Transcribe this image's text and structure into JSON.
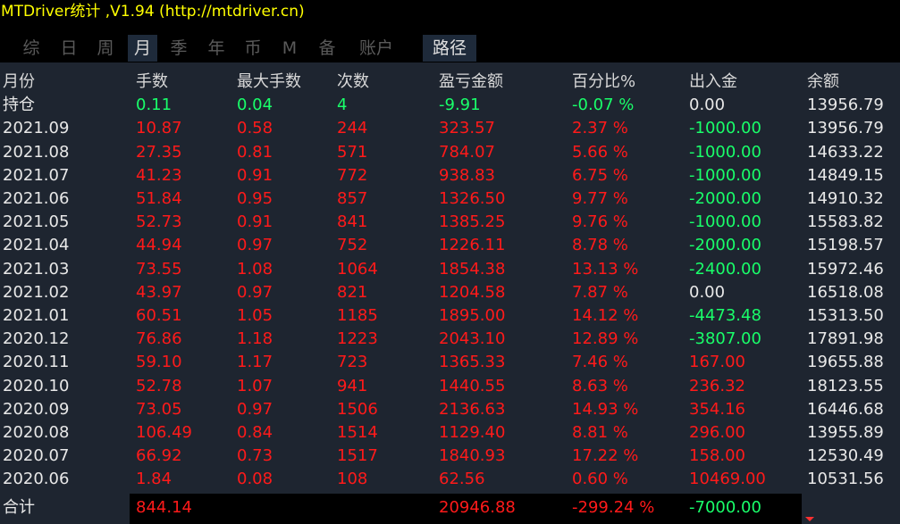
{
  "window": {
    "title": "MTDriver统计 ,V1.94 (http://mtdriver.cn)"
  },
  "tabs": [
    {
      "label": "综",
      "active": false
    },
    {
      "label": "日",
      "active": false
    },
    {
      "label": "周",
      "active": false
    },
    {
      "label": "月",
      "active": true
    },
    {
      "label": "季",
      "active": false
    },
    {
      "label": "年",
      "active": false
    },
    {
      "label": "币",
      "active": false
    },
    {
      "label": "M",
      "active": false
    },
    {
      "label": "备",
      "active": false
    },
    {
      "label": "账户",
      "active": false
    },
    {
      "label": "路径",
      "active": false
    }
  ],
  "table": {
    "headers": [
      "月份",
      "手数",
      "最大手数",
      "次数",
      "盈亏金额",
      "百分比%",
      "出入金",
      "余额"
    ],
    "rows": [
      [
        "持仓",
        "0.11",
        "0.04",
        "4",
        "-9.91",
        "-0.07 %",
        "0.00",
        "13956.79"
      ],
      [
        "2021.09",
        "10.87",
        "0.58",
        "244",
        "323.57",
        "2.37 %",
        "-1000.00",
        "13956.79"
      ],
      [
        "2021.08",
        "27.35",
        "0.81",
        "571",
        "784.07",
        "5.66 %",
        "-1000.00",
        "14633.22"
      ],
      [
        "2021.07",
        "41.23",
        "0.91",
        "772",
        "938.83",
        "6.75 %",
        "-1000.00",
        "14849.15"
      ],
      [
        "2021.06",
        "51.84",
        "0.95",
        "857",
        "1326.50",
        "9.77 %",
        "-2000.00",
        "14910.32"
      ],
      [
        "2021.05",
        "52.73",
        "0.91",
        "841",
        "1385.25",
        "9.76 %",
        "-1000.00",
        "15583.82"
      ],
      [
        "2021.04",
        "44.94",
        "0.97",
        "752",
        "1226.11",
        "8.78 %",
        "-2000.00",
        "15198.57"
      ],
      [
        "2021.03",
        "73.55",
        "1.08",
        "1064",
        "1854.38",
        "13.13 %",
        "-2400.00",
        "15972.46"
      ],
      [
        "2021.02",
        "43.97",
        "0.97",
        "821",
        "1204.58",
        "7.87 %",
        "0.00",
        "16518.08"
      ],
      [
        "2021.01",
        "60.51",
        "1.05",
        "1185",
        "1895.00",
        "14.12 %",
        "-4473.48",
        "15313.50"
      ],
      [
        "2020.12",
        "76.86",
        "1.18",
        "1223",
        "2043.10",
        "12.89 %",
        "-3807.00",
        "17891.98"
      ],
      [
        "2020.11",
        "59.10",
        "1.17",
        "723",
        "1365.33",
        "7.46 %",
        "167.00",
        "19655.88"
      ],
      [
        "2020.10",
        "52.78",
        "1.07",
        "941",
        "1440.55",
        "8.63 %",
        "236.32",
        "18123.55"
      ],
      [
        "2020.09",
        "73.05",
        "0.97",
        "1506",
        "2136.63",
        "14.93 %",
        "354.16",
        "16446.68"
      ],
      [
        "2020.08",
        "106.49",
        "0.84",
        "1514",
        "1129.40",
        "8.81 %",
        "296.00",
        "13955.89"
      ],
      [
        "2020.07",
        "66.92",
        "0.73",
        "1517",
        "1840.93",
        "17.22 %",
        "158.00",
        "12530.49"
      ],
      [
        "2020.06",
        "1.84",
        "0.08",
        "108",
        "62.56",
        "0.60 %",
        "10469.00",
        "10531.56"
      ]
    ],
    "row_colors": [
      [
        "#e8e8e8",
        "#19ff6a",
        "#19ff6a",
        "#19ff6a",
        "#19ff6a",
        "#19ff6a",
        "#e8e8e8",
        "#e8e8e8"
      ],
      [
        "#e8e8e8",
        "#ff1a1a",
        "#ff1a1a",
        "#ff1a1a",
        "#ff1a1a",
        "#ff1a1a",
        "#19ff6a",
        "#e8e8e8"
      ],
      [
        "#e8e8e8",
        "#ff1a1a",
        "#ff1a1a",
        "#ff1a1a",
        "#ff1a1a",
        "#ff1a1a",
        "#19ff6a",
        "#e8e8e8"
      ],
      [
        "#e8e8e8",
        "#ff1a1a",
        "#ff1a1a",
        "#ff1a1a",
        "#ff1a1a",
        "#ff1a1a",
        "#19ff6a",
        "#e8e8e8"
      ],
      [
        "#e8e8e8",
        "#ff1a1a",
        "#ff1a1a",
        "#ff1a1a",
        "#ff1a1a",
        "#ff1a1a",
        "#19ff6a",
        "#e8e8e8"
      ],
      [
        "#e8e8e8",
        "#ff1a1a",
        "#ff1a1a",
        "#ff1a1a",
        "#ff1a1a",
        "#ff1a1a",
        "#19ff6a",
        "#e8e8e8"
      ],
      [
        "#e8e8e8",
        "#ff1a1a",
        "#ff1a1a",
        "#ff1a1a",
        "#ff1a1a",
        "#ff1a1a",
        "#19ff6a",
        "#e8e8e8"
      ],
      [
        "#e8e8e8",
        "#ff1a1a",
        "#ff1a1a",
        "#ff1a1a",
        "#ff1a1a",
        "#ff1a1a",
        "#19ff6a",
        "#e8e8e8"
      ],
      [
        "#e8e8e8",
        "#ff1a1a",
        "#ff1a1a",
        "#ff1a1a",
        "#ff1a1a",
        "#ff1a1a",
        "#e8e8e8",
        "#e8e8e8"
      ],
      [
        "#e8e8e8",
        "#ff1a1a",
        "#ff1a1a",
        "#ff1a1a",
        "#ff1a1a",
        "#ff1a1a",
        "#19ff6a",
        "#e8e8e8"
      ],
      [
        "#e8e8e8",
        "#ff1a1a",
        "#ff1a1a",
        "#ff1a1a",
        "#ff1a1a",
        "#ff1a1a",
        "#19ff6a",
        "#e8e8e8"
      ],
      [
        "#e8e8e8",
        "#ff1a1a",
        "#ff1a1a",
        "#ff1a1a",
        "#ff1a1a",
        "#ff1a1a",
        "#ff1a1a",
        "#e8e8e8"
      ],
      [
        "#e8e8e8",
        "#ff1a1a",
        "#ff1a1a",
        "#ff1a1a",
        "#ff1a1a",
        "#ff1a1a",
        "#ff1a1a",
        "#e8e8e8"
      ],
      [
        "#e8e8e8",
        "#ff1a1a",
        "#ff1a1a",
        "#ff1a1a",
        "#ff1a1a",
        "#ff1a1a",
        "#ff1a1a",
        "#e8e8e8"
      ],
      [
        "#e8e8e8",
        "#ff1a1a",
        "#ff1a1a",
        "#ff1a1a",
        "#ff1a1a",
        "#ff1a1a",
        "#ff1a1a",
        "#e8e8e8"
      ],
      [
        "#e8e8e8",
        "#ff1a1a",
        "#ff1a1a",
        "#ff1a1a",
        "#ff1a1a",
        "#ff1a1a",
        "#ff1a1a",
        "#e8e8e8"
      ],
      [
        "#e8e8e8",
        "#ff1a1a",
        "#ff1a1a",
        "#ff1a1a",
        "#ff1a1a",
        "#ff1a1a",
        "#ff1a1a",
        "#e8e8e8"
      ]
    ]
  },
  "footer": {
    "label": "合计",
    "lots": "844.14",
    "profit": "20946.88",
    "percent": "-299.24 %",
    "deposit": "-7000.00"
  },
  "colors": {
    "title": "#ffff00",
    "profit_red": "#ff1a1a",
    "loss_green": "#19ff6a",
    "text": "#e8e8e8",
    "panel_bg": "#1e2530"
  }
}
